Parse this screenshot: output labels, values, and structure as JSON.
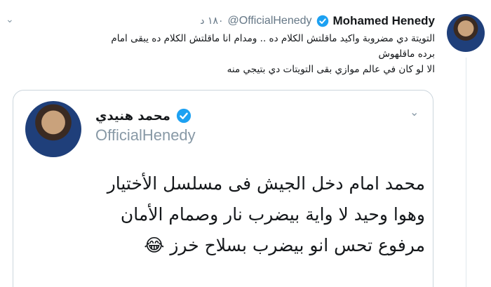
{
  "tweet": {
    "display_name": "Mohamed Henedy",
    "handle": "@OfficialHenedy",
    "time": "١٨٠ د",
    "lines": [
      "التويتة دي مضروبة واكيد ماقلتش الكلام ده .. ومدام انا ماقلتش الكلام ده يبقى امام",
      "برده ماقلهوش",
      "الا لو كان في عالم موازي بقى التويتات دي بتيجي منه"
    ]
  },
  "quoted": {
    "display_name": "محمد هنيدي",
    "handle": "OfficialHenedy",
    "lines": [
      "محمد امام دخل الجيش فى مسلسل الأختيار",
      "وهوا وحيد لا واية بيضرب نار وصمام الأمان",
      "مرفوع تحس انو بيضرب بسلاح خرز"
    ],
    "emoji": "😂"
  },
  "colors": {
    "verified": "#1da1f2",
    "secondary_text": "#657786",
    "border": "#ccd6dd"
  },
  "icons": {
    "verified": "verified-badge-icon",
    "chevron": "chevron-down-icon"
  }
}
